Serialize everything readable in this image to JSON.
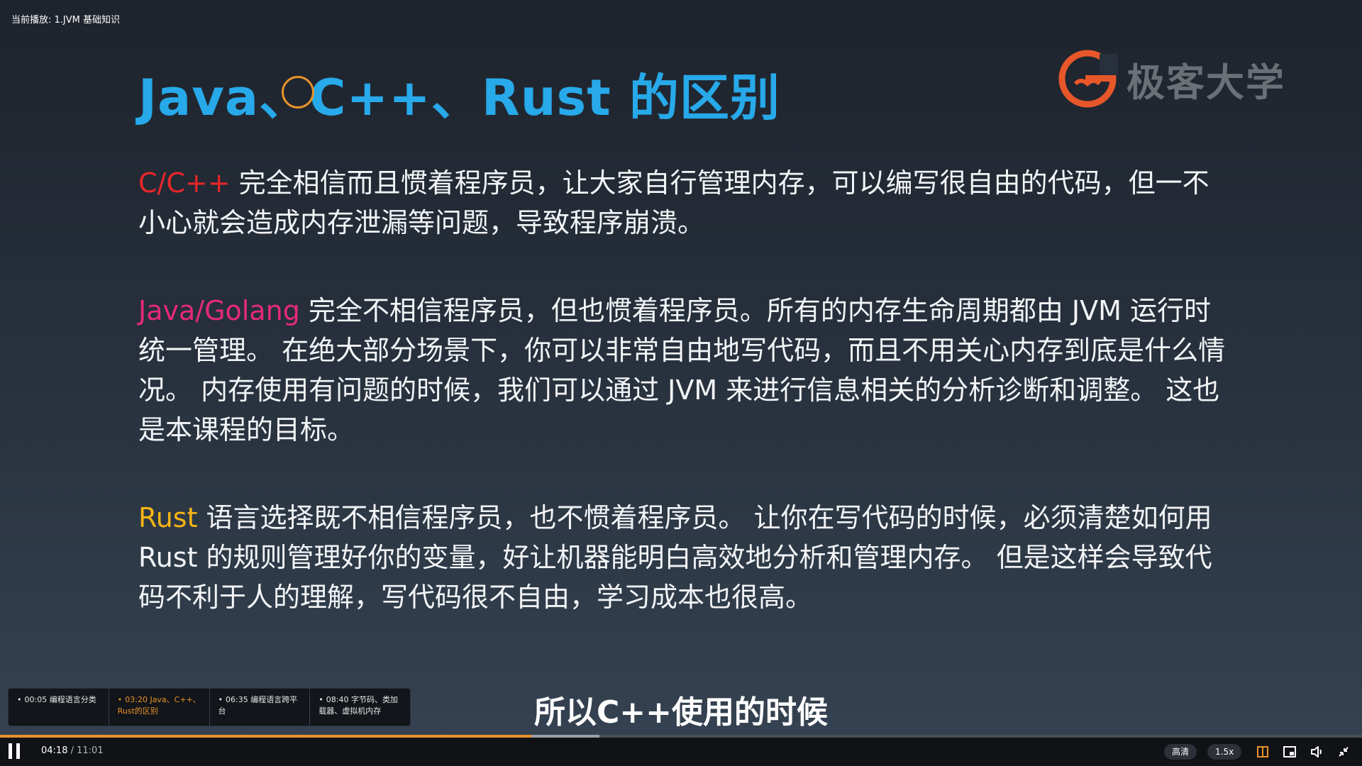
{
  "header": {
    "now_playing": "当前播放: 1.JVM 基础知识"
  },
  "slide": {
    "title": "Java、C++、Rust 的区别",
    "logo_text": "极客大学",
    "paragraphs": [
      {
        "keyword": "C/C++",
        "keyword_color": "#e8262a",
        "text": "完全相信而且惯着程序员，让大家自行管理内存，可以编写很自由的代码，但一不小心就会造成内存泄漏等问题，导致程序崩溃。"
      },
      {
        "keyword": "Java/Golang",
        "keyword_color": "#e52a7a",
        "text": "完全不相信程序员，但也惯着程序员。所有的内存生命周期都由 JVM 运行时统一管理。 在绝大部分场景下，你可以非常自由地写代码，而且不用关心内存到底是什么情况。 内存使用有问题的时候，我们可以通过 JVM 来进行信息相关的分析诊断和调整。 这也是本课程的目标。"
      },
      {
        "keyword": "Rust",
        "keyword_color": "#f5b415",
        "text": "语言选择既不相信程序员，也不惯着程序员。 让你在写代码的时候，必须清楚如何用 Rust 的规则管理好你的变量，好让机器能明白高效地分析和管理内存。 但是这样会导致代码不利于人的理解，写代码很不自由，学习成本也很高。"
      }
    ]
  },
  "chapters": [
    {
      "label": "00:05 编程语言分类",
      "active": false
    },
    {
      "label": "03:20 Java、C++、Rust的区别",
      "active": true
    },
    {
      "label": "06:35 编程语言跨平台",
      "active": false
    },
    {
      "label": "08:40 字节码、类加载器、虚拟机内存",
      "active": false
    }
  ],
  "subtitle": "所以C++使用的时候",
  "player": {
    "current_time": "04:18",
    "separator": " / ",
    "total_time": "11:01",
    "progress_fraction": 0.39,
    "buffered_fraction": 0.44,
    "quality_label": "高清",
    "speed_label": "1.5x",
    "accent_color": "#e8922a"
  },
  "icons": {
    "pause": "pause-icon",
    "chapters": "chapters-icon",
    "pip": "picture-in-picture-icon",
    "volume": "volume-icon",
    "exit_fullscreen": "exit-fullscreen-icon"
  }
}
